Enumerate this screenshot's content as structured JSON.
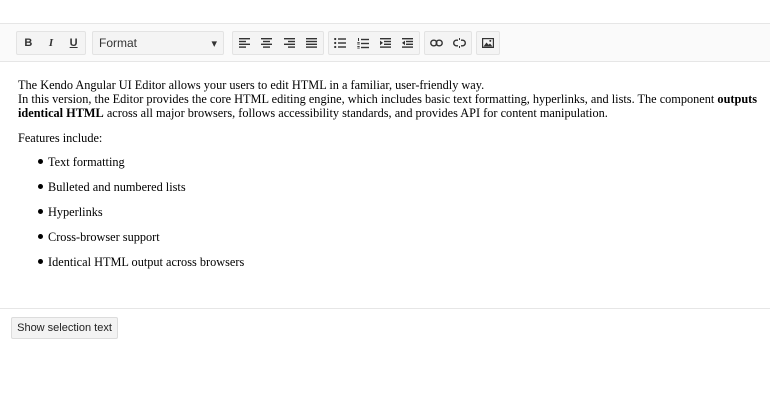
{
  "toolbar": {
    "bold_label": "B",
    "italic_label": "I",
    "underline_label": "U",
    "format_dropdown": {
      "selected": "Format",
      "caret": "▾"
    },
    "icons": {
      "align": [
        "align-left-icon",
        "align-center-icon",
        "align-right-icon",
        "align-justify-icon"
      ],
      "lists_indent": [
        "bullet-list-icon",
        "numbered-list-icon",
        "indent-icon",
        "outdent-icon"
      ],
      "links": [
        "link-icon",
        "unlink-icon"
      ],
      "image": "image-icon"
    }
  },
  "content": {
    "para1_line1": "The Kendo Angular UI Editor allows your users to edit HTML in a familiar, user-friendly way.",
    "para1_line2a": "In this version, the Editor provides the core HTML editing engine, which includes basic text formatting, hyperlinks, and lists. The component ",
    "para1_bold": "outputs identical HTML",
    "para1_line2b": " across all major browsers, follows accessibility standards, and provides API for content manipulation.",
    "features_heading": "Features include:",
    "features": [
      "Text formatting",
      "Bulleted and numbered lists",
      "Hyperlinks",
      "Cross-browser support",
      "Identical HTML output across browsers"
    ]
  },
  "show_selection_button": "Show selection text",
  "colors": {
    "toolbar_bg": "#fafafa",
    "border": "#e6e6e6",
    "icon": "#333333"
  }
}
